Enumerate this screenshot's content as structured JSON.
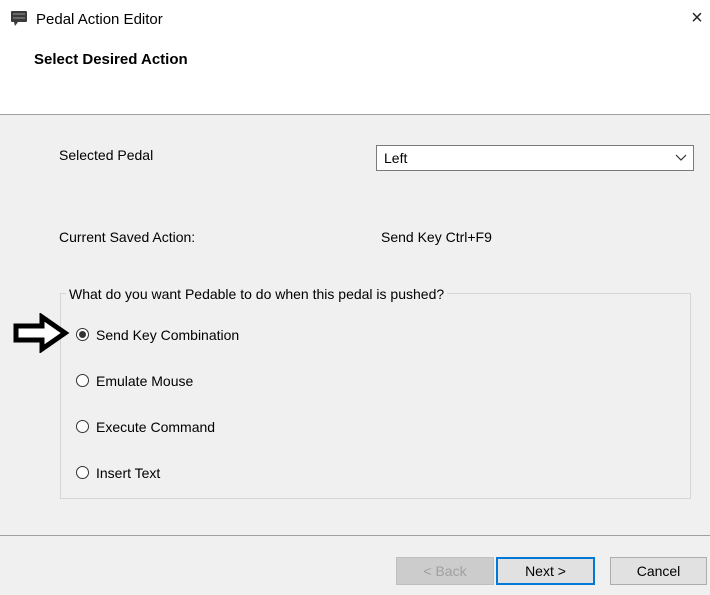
{
  "window": {
    "title": "Pedal Action Editor",
    "close_glyph": "×",
    "app_icon": "pedal-app-icon"
  },
  "header": {
    "subtitle": "Select Desired Action"
  },
  "form": {
    "selected_pedal_label": "Selected Pedal",
    "selected_pedal_value": "Left",
    "current_action_label": "Current Saved Action:",
    "current_action_value": "Send Key Ctrl+F9"
  },
  "action_group": {
    "legend": "What do you want Pedable to do when this pedal is pushed?",
    "options": [
      {
        "label": "Send Key Combination",
        "checked": true
      },
      {
        "label": "Emulate Mouse",
        "checked": false
      },
      {
        "label": "Execute Command",
        "checked": false
      },
      {
        "label": "Insert Text",
        "checked": false
      }
    ]
  },
  "buttons": {
    "back_label": "< Back",
    "next_label": "Next >",
    "cancel_label": "Cancel"
  },
  "colors": {
    "accent": "#0078d7",
    "panel": "#f0f0f0",
    "disabled_text": "#a0a0a0"
  }
}
